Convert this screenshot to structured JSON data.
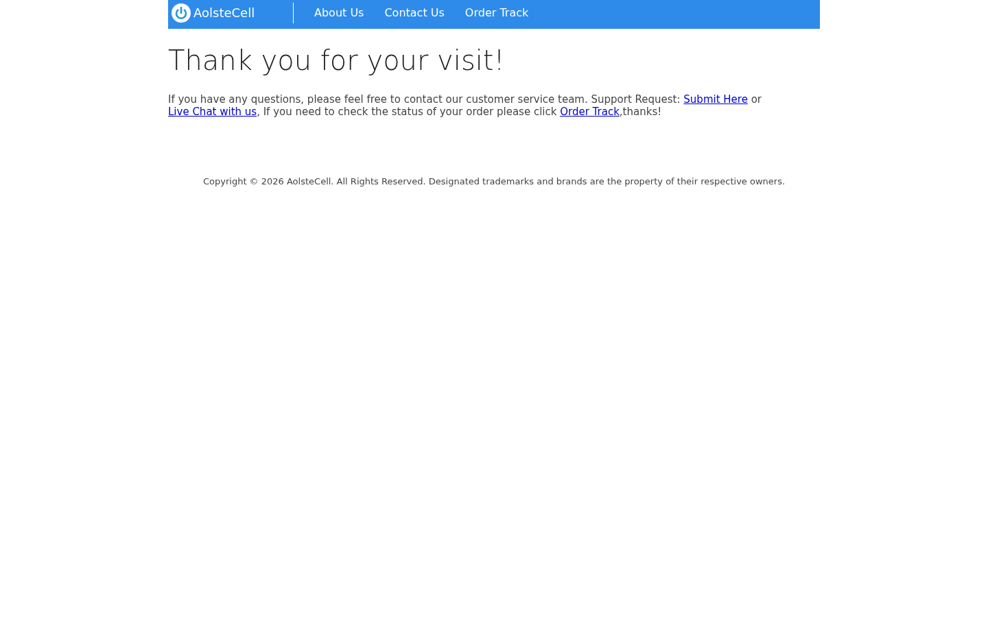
{
  "header": {
    "brand": "AolsteCell",
    "nav": [
      {
        "label": "About Us"
      },
      {
        "label": "Contact Us"
      },
      {
        "label": "Order Track"
      }
    ]
  },
  "main": {
    "title": "Thank you for your visit!",
    "message": [
      {
        "kind": "text",
        "text": "If you have any questions, please feel free to contact our customer service team. Support Request: "
      },
      {
        "kind": "link",
        "text": "Submit Here"
      },
      {
        "kind": "text",
        "text": " or "
      },
      {
        "kind": "link",
        "text": "Live Chat with us"
      },
      {
        "kind": "text",
        "text": ", If you need to check the status of your order please click "
      },
      {
        "kind": "link",
        "text": "Order Track"
      },
      {
        "kind": "text",
        "text": ",thanks!"
      }
    ]
  },
  "footer": {
    "copyright": "Copyright © 2026 AolsteCell. All Rights Reserved. Designated trademarks and brands are the property of their respective owners."
  }
}
